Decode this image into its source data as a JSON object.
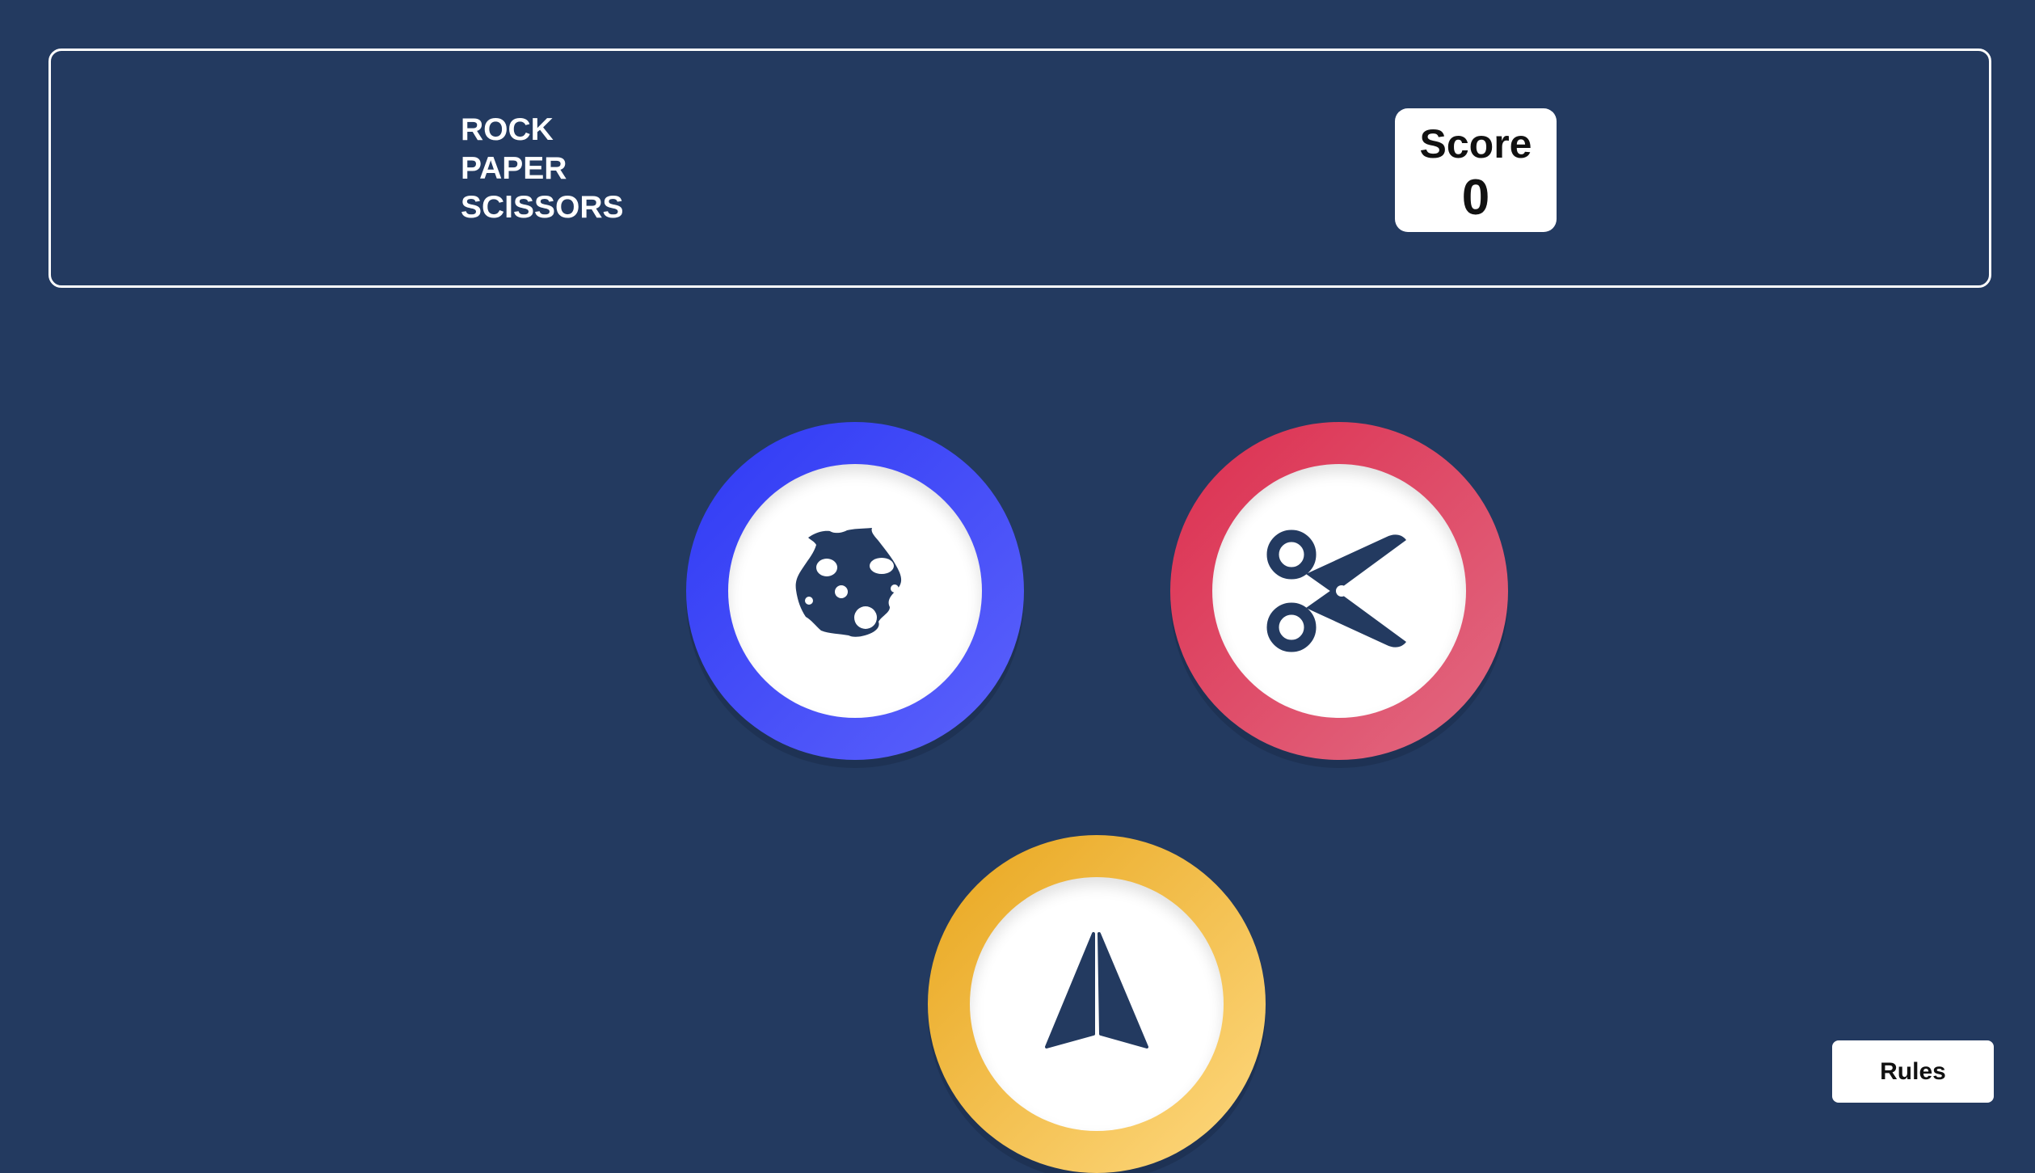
{
  "header": {
    "title_lines": [
      "ROCK",
      "PAPER",
      "SCISSORS"
    ],
    "score": {
      "label": "Score",
      "value": "0"
    }
  },
  "choices": [
    {
      "name": "rock",
      "icon": "rock-icon",
      "ring_colors": [
        "#2f3af5",
        "#5c62fb"
      ]
    },
    {
      "name": "scissors",
      "icon": "scissors-icon",
      "ring_colors": [
        "#dc2f50",
        "#e26a82"
      ]
    },
    {
      "name": "paper",
      "icon": "paper-icon",
      "ring_colors": [
        "#e8a61e",
        "#fed980"
      ]
    }
  ],
  "rules_button": {
    "label": "Rules"
  },
  "colors": {
    "background": "#233a60",
    "icon": "#233a60"
  }
}
